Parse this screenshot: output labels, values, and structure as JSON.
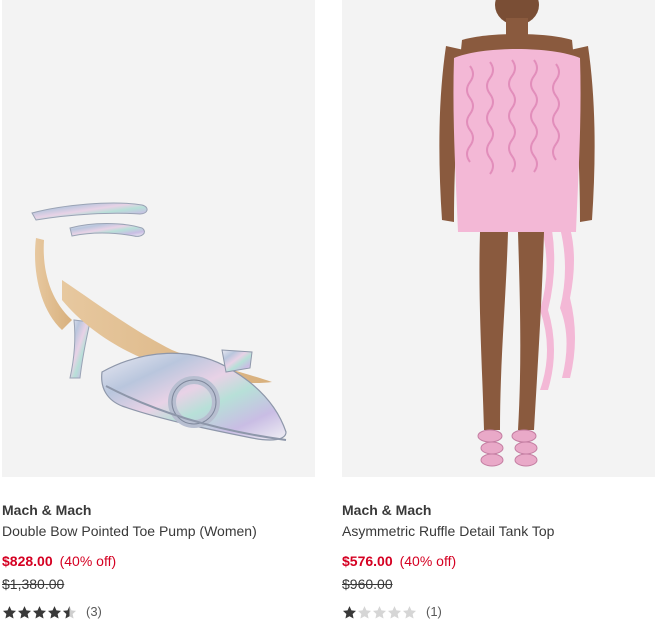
{
  "products": [
    {
      "brand": "Mach & Mach",
      "title": "Double Bow Pointed Toe Pump (Women)",
      "price": "$828.00",
      "discount": "(40% off)",
      "original_price": "$1,380.00",
      "rating": 4.5,
      "review_count": "(3)",
      "image": "silver-holographic-pump"
    },
    {
      "brand": "Mach & Mach",
      "title": "Asymmetric Ruffle Detail Tank Top",
      "price": "$576.00",
      "discount": "(40% off)",
      "original_price": "$960.00",
      "rating": 1,
      "review_count": "(1)",
      "image": "pink-ruffle-dress"
    }
  ],
  "colors": {
    "sale": "#d50022",
    "text": "#393939",
    "star_filled": "#393939",
    "star_empty": "#cfcfcf",
    "image_bg": "#f3f3f3"
  }
}
